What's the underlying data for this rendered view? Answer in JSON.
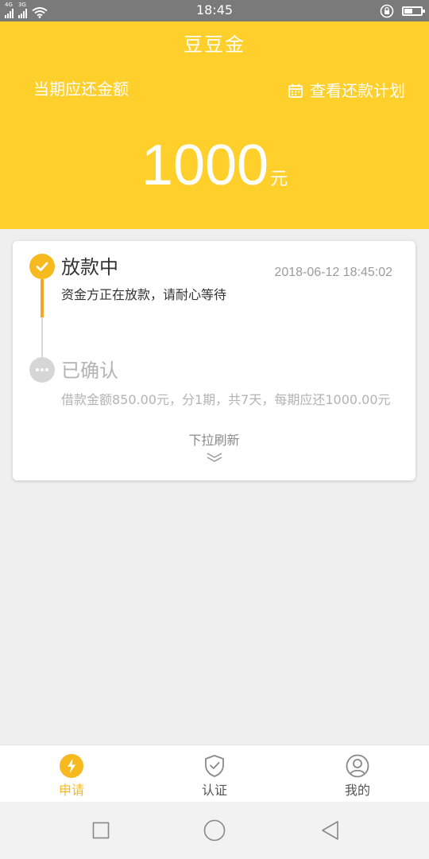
{
  "status_bar": {
    "time": "18:45",
    "network_1": "4G",
    "network_2": "3G",
    "battery_level": 0.5
  },
  "header": {
    "title": "豆豆金",
    "due_label": "当期应还金额",
    "plan_link": "查看还款计划",
    "amount": "1000",
    "unit": "元"
  },
  "timeline": {
    "step1": {
      "title": "放款中",
      "time": "2018-06-12 18:45:02",
      "desc": "资金方正在放款，请耐心等待",
      "status": "done"
    },
    "step2": {
      "title": "已确认",
      "desc": "借款金额850.00元，分1期，共7天，每期应还1000.00元",
      "status": "pending"
    },
    "pull_hint": "下拉刷新"
  },
  "tabs": [
    {
      "label": "申请",
      "icon": "lightning-icon",
      "active": true
    },
    {
      "label": "认证",
      "icon": "shield-check-icon",
      "active": false
    },
    {
      "label": "我的",
      "icon": "user-icon",
      "active": false
    }
  ],
  "colors": {
    "brand_yellow": "#ffcf2b",
    "active_dot": "#f6b91e",
    "progress_line": "#f5a623",
    "pending_gray": "#d6d6d6"
  }
}
